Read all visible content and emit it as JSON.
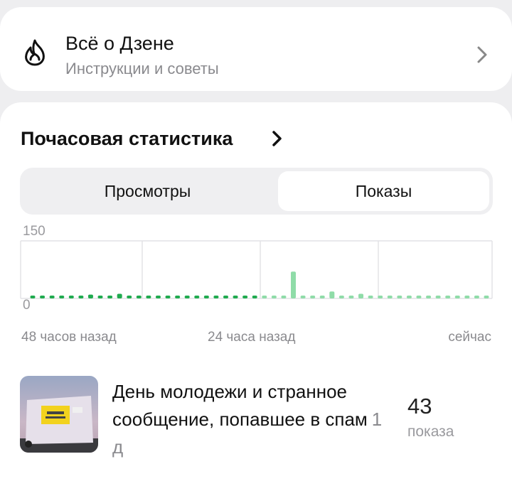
{
  "zen_card": {
    "title": "Всё о Дзене",
    "subtitle": "Инструкции и советы"
  },
  "stats": {
    "title": "Почасовая статистика",
    "tabs": [
      {
        "label": "Просмотры",
        "active": false
      },
      {
        "label": "Показы",
        "active": true
      }
    ]
  },
  "chart_data": {
    "type": "bar",
    "ylim": [
      0,
      150
    ],
    "y_ticks": [
      "150",
      "0"
    ],
    "x_labels": [
      "48 часов назад",
      "24 часа назад",
      "сейчас"
    ],
    "grid": true,
    "series": [
      {
        "values": [
          2,
          3,
          3,
          3,
          3,
          3,
          10,
          3,
          4,
          12,
          3,
          3,
          3,
          3,
          3,
          3,
          3,
          3,
          3,
          3,
          3,
          3,
          3,
          3,
          3,
          3,
          3,
          70,
          4,
          3,
          3,
          18,
          3,
          3,
          12,
          3,
          3,
          3,
          3,
          3,
          3,
          3,
          3,
          3,
          3,
          3,
          3,
          3
        ],
        "colors": [
          "#1faa4e",
          "#1faa4e",
          "#1faa4e",
          "#1faa4e",
          "#1faa4e",
          "#1faa4e",
          "#1faa4e",
          "#1faa4e",
          "#1faa4e",
          "#1faa4e",
          "#1faa4e",
          "#1faa4e",
          "#1faa4e",
          "#1faa4e",
          "#1faa4e",
          "#1faa4e",
          "#1faa4e",
          "#1faa4e",
          "#1faa4e",
          "#1faa4e",
          "#1faa4e",
          "#1faa4e",
          "#1faa4e",
          "#1faa4e",
          "#8fdca8",
          "#8fdca8",
          "#8fdca8",
          "#8fdca8",
          "#8fdca8",
          "#8fdca8",
          "#8fdca8",
          "#8fdca8",
          "#8fdca8",
          "#8fdca8",
          "#8fdca8",
          "#8fdca8",
          "#8fdca8",
          "#8fdca8",
          "#8fdca8",
          "#8fdca8",
          "#8fdca8",
          "#8fdca8",
          "#8fdca8",
          "#8fdca8",
          "#8fdca8",
          "#8fdca8",
          "#8fdca8",
          "#8fdca8"
        ]
      }
    ]
  },
  "article": {
    "title": "День молодежи и странное сообщение, попавшее в спам",
    "age": "1 д",
    "count": "43",
    "count_label": "показа",
    "thumbnail": "photo of a white stand with yellow poster under evening sky"
  },
  "colors": {
    "bar_past": "#1faa4e",
    "bar_recent": "#8fdca8",
    "background": "#eeeef0"
  }
}
